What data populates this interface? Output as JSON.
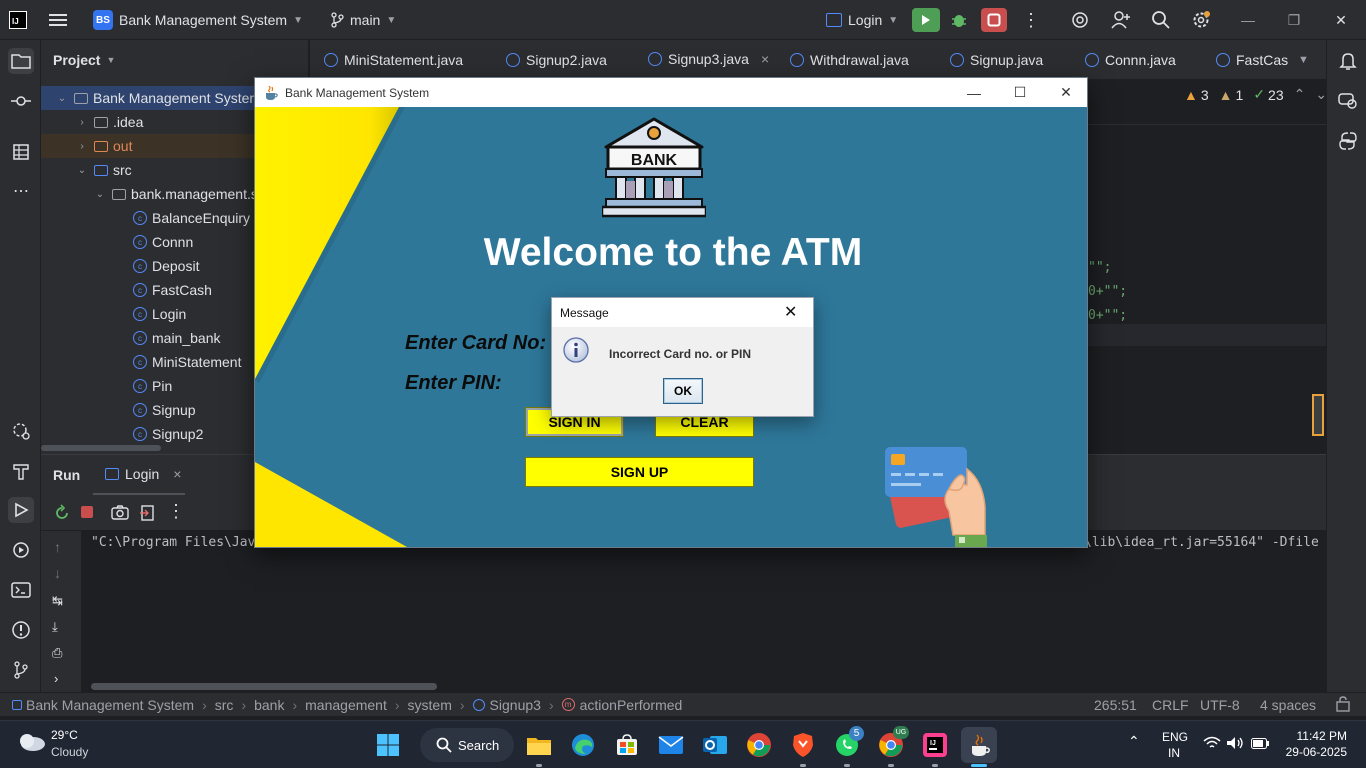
{
  "ide": {
    "project_badge": "BS",
    "project_name": "Bank Management System",
    "branch": "main",
    "run_config": "Login"
  },
  "project_panel": {
    "title": "Project",
    "tree": [
      {
        "label": "Bank Management System",
        "level": 0,
        "kind": "module"
      },
      {
        "label": ".idea",
        "level": 1,
        "kind": "folder"
      },
      {
        "label": "out",
        "level": 1,
        "kind": "folder-excluded"
      },
      {
        "label": "src",
        "level": 1,
        "kind": "folder-src"
      },
      {
        "label": "bank.management.s",
        "level": 2,
        "kind": "package"
      },
      {
        "label": "BalanceEnquiry",
        "level": 3,
        "kind": "class"
      },
      {
        "label": "Connn",
        "level": 3,
        "kind": "class"
      },
      {
        "label": "Deposit",
        "level": 3,
        "kind": "class"
      },
      {
        "label": "FastCash",
        "level": 3,
        "kind": "class"
      },
      {
        "label": "Login",
        "level": 3,
        "kind": "class"
      },
      {
        "label": "main_bank",
        "level": 3,
        "kind": "class"
      },
      {
        "label": "MiniStatement",
        "level": 3,
        "kind": "class"
      },
      {
        "label": "Pin",
        "level": 3,
        "kind": "class"
      },
      {
        "label": "Signup",
        "level": 3,
        "kind": "class"
      },
      {
        "label": "Signup2",
        "level": 3,
        "kind": "class"
      }
    ]
  },
  "editor": {
    "tabs": [
      {
        "label": "MiniStatement.java",
        "active": false
      },
      {
        "label": "Signup2.java",
        "active": false
      },
      {
        "label": "Signup3.java",
        "active": true,
        "close": "×"
      },
      {
        "label": "Withdrawal.java",
        "active": false
      },
      {
        "label": "Signup.java",
        "active": false
      },
      {
        "label": "Connn.java",
        "active": false
      },
      {
        "label": "FastCas",
        "active": false
      }
    ],
    "inspections": {
      "warnings": "3",
      "weak": "1",
      "typos": "23"
    },
    "code_fragments": [
      "\"\";",
      "0+\"\";",
      "0+\"\";"
    ]
  },
  "run_panel": {
    "title": "Run",
    "tab_label": "Login",
    "tab_close": "×",
    "console_left": "\"C:\\Program Files\\Jav",
    "console_right": "\\lib\\idea_rt.jar=55164\" -Dfile"
  },
  "statusbar": {
    "breadcrumbs": [
      "Bank Management System",
      "src",
      "bank",
      "management",
      "system",
      "Signup3",
      "actionPerformed"
    ],
    "position": "265:51",
    "line_sep": "CRLF",
    "encoding": "UTF-8",
    "indent": "4 spaces"
  },
  "swing_window": {
    "title": "Bank Management System",
    "bank_sign": "BANK",
    "heading": "Welcome to the ATM",
    "card_label": "Enter Card No:",
    "pin_label": "Enter PIN:",
    "signin_label": "SIGN IN",
    "clear_label": "CLEAR",
    "signup_label": "SIGN UP",
    "colors": {
      "background": "#2e7799",
      "accent": "#ffff00"
    }
  },
  "dialog": {
    "title": "Message",
    "message": "Incorrect Card no. or PIN",
    "ok_label": "OK"
  },
  "taskbar": {
    "temperature": "29°C",
    "weather": "Cloudy",
    "search_label": "Search",
    "whatsapp_badge": "5",
    "chrome_badge": "UG",
    "lang_top": "ENG",
    "lang_bottom": "IN",
    "time": "11:42 PM",
    "date": "29-06-2025"
  }
}
